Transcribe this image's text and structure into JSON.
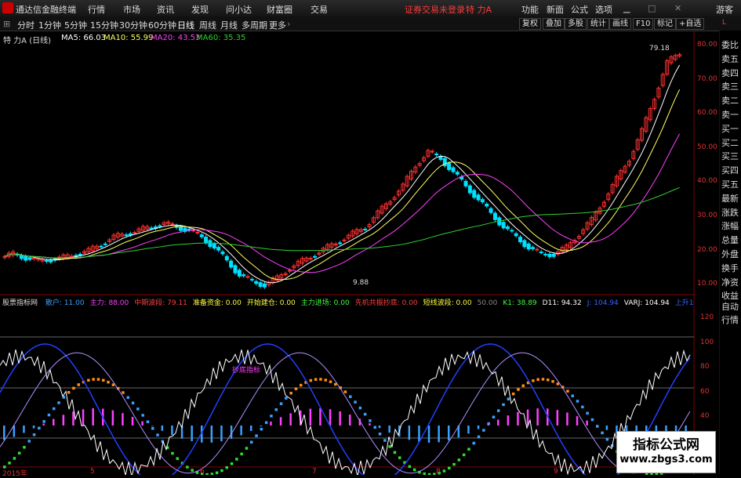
{
  "titlebar": {
    "app_title": "通达信金融终端",
    "menus": [
      "行情",
      "市场",
      "资讯",
      "发现",
      "问小达",
      "财富圈",
      "交易"
    ],
    "login_status": "证券交易未登录",
    "stock_name": "特 力A",
    "right_menus": [
      "功能",
      "新面",
      "公式",
      "选项"
    ],
    "guest": "游客"
  },
  "toolbar": {
    "periods": [
      "分时",
      "1分钟",
      "5分钟",
      "15分钟",
      "30分钟",
      "60分钟",
      "日线",
      "周线",
      "月线",
      "多周期",
      "更多"
    ],
    "active_period": "日线",
    "right_buttons": [
      "复权",
      "叠加",
      "多股",
      "统计",
      "画线",
      "F10",
      "标记",
      "+自选"
    ]
  },
  "main_legend": {
    "name": "特 力A (日线)",
    "ma5": "MA5: 66.03",
    "ma10": "MA10: 55.99",
    "ma20": "MA20: 43.53",
    "ma60": "MA60: 35.35"
  },
  "price_axis": [
    "80.00",
    "70.00",
    "60.00",
    "50.00",
    "40.00",
    "30.00",
    "20.00",
    "10.00"
  ],
  "annotations": {
    "high": "79.18",
    "low": "9.88"
  },
  "indicator_legend": {
    "name": "股票指标网",
    "items": [
      {
        "text": "散户: 11.00",
        "color": "#3aa0ff"
      },
      {
        "text": "主力: 88.00",
        "color": "#ff40ff"
      },
      {
        "text": "中期波段: 79.11",
        "color": "#ff4040"
      },
      {
        "text": "准备资金: 0.00",
        "color": "#ffff40"
      },
      {
        "text": "开始建仓: 0.00",
        "color": "#ffff40"
      },
      {
        "text": "主力进场: 0.00",
        "color": "#40ff40"
      },
      {
        "text": "先机共振抄底: 0.00",
        "color": "#ff4040"
      },
      {
        "text": "短线波段: 0.00",
        "color": "#ffff40"
      },
      {
        "text": "50.00",
        "color": "#888888"
      },
      {
        "text": "K1: 38.89",
        "color": "#40ff40"
      },
      {
        "text": "D11: 94.32",
        "color": "#ffffff"
      },
      {
        "text": "J: 104.94",
        "color": "#3a60ff"
      },
      {
        "text": "VARJ: 104.94",
        "color": "#ffffff"
      },
      {
        "text": "上升1",
        "color": "#3a60ff"
      }
    ],
    "inline_label": "抄底指标"
  },
  "indicator_axis": [
    "120",
    "100",
    "80",
    "60",
    "40",
    "20"
  ],
  "date_axis": [
    "2015年",
    "5",
    "6",
    "7",
    "8",
    "9"
  ],
  "right_panel": [
    "委比",
    "卖五",
    "卖四",
    "卖三",
    "卖二",
    "卖一",
    "买一",
    "买二",
    "买三",
    "买四",
    "买五",
    "最新",
    "涨跌",
    "涨幅",
    "总量",
    "外盘",
    "换手",
    "净资",
    "收益"
  ],
  "right_panel_bottom": [
    "自动",
    "行情"
  ],
  "watermark": {
    "line1": "指标公式网",
    "line2": "www.zbgs3.com"
  },
  "colors": {
    "up": "#ff3030",
    "down": "#00e0ff",
    "ma5": "#ffffff",
    "ma10": "#ffff60",
    "ma20": "#ff40ff",
    "ma60": "#30d030"
  }
}
